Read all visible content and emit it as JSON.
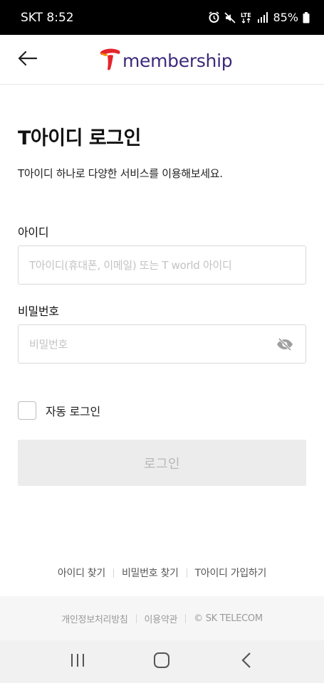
{
  "status_bar": {
    "carrier_time": "SKT 8:52",
    "battery": "85%",
    "icons": [
      "alarm-icon",
      "mute-icon",
      "lte-icon",
      "signal-icon",
      "battery-icon"
    ]
  },
  "header": {
    "brand": "membership",
    "back_icon": "arrow-left-icon",
    "logo_icon": "t-logo-icon"
  },
  "login": {
    "title": "T아이디 로그인",
    "subtitle": "T아이디 하나로 다양한 서비스를 이용해보세요.",
    "id_label": "아이디",
    "id_placeholder": "T아이디(휴대폰, 이메일) 또는 T world 아이디",
    "id_value": "",
    "pw_label": "비밀번호",
    "pw_placeholder": "비밀번호",
    "pw_value": "",
    "auto_login_label": "자동 로그인",
    "auto_login_checked": false,
    "login_button": "로그인"
  },
  "links": {
    "find_id": "아이디 찾기",
    "find_pw": "비밀번호 찾기",
    "signup": "T아이디 가입하기"
  },
  "footer": {
    "privacy": "개인정보처리방침",
    "terms": "이용약관",
    "copyright": "© SK TELECOM"
  },
  "colors": {
    "brand_purple": "#3d2a7a",
    "logo_red": "#e5242b",
    "logo_orange": "#f39200",
    "button_disabled_bg": "#ececec",
    "button_disabled_text": "#b7b7b7"
  }
}
